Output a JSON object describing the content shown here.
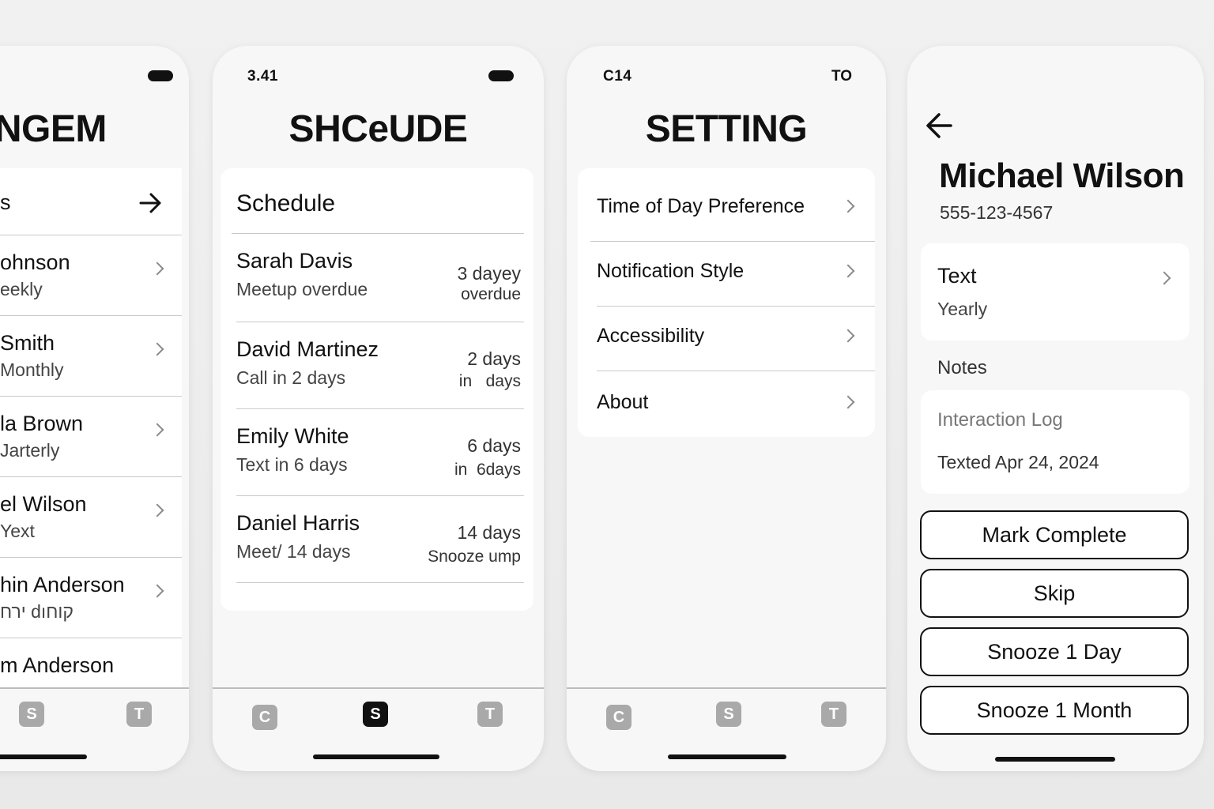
{
  "contacts_screen": {
    "title": "INGEM",
    "section_label": "s",
    "items": [
      {
        "name": "ohnson",
        "frequency": "eekly"
      },
      {
        "name": "Smith",
        "frequency": "Monthly"
      },
      {
        "name": "la Brown",
        "frequency": "Jarterly"
      },
      {
        "name": "el Wilson",
        "frequency": "Yext"
      },
      {
        "name": "hin Anderson",
        "frequency": "ירח dıקוח"
      },
      {
        "name": "m Anderson",
        "frequency": ""
      }
    ],
    "tabs": [
      "S",
      "T"
    ]
  },
  "schedule_screen": {
    "status_time": "3.41",
    "title": "SHCeUDE",
    "card_header": "Schedule",
    "items": [
      {
        "name": "Sarah Davis",
        "detail": "Meetup overdue",
        "due_primary": "3 dayey",
        "due_secondary": "overdue"
      },
      {
        "name": "David Martinez",
        "detail": "Call in 2 days",
        "due_primary": "2 days",
        "due_secondary": "in   days"
      },
      {
        "name": "Emily White",
        "detail": "Text in 6 days",
        "due_primary": "6 days",
        "due_secondary": "in  6days"
      },
      {
        "name": "Daniel Harris",
        "detail": "Meet/ 14 days",
        "due_primary": "14 days",
        "due_secondary": "Snooze ump"
      }
    ],
    "tabs": [
      "C",
      "S",
      "T"
    ]
  },
  "settings_screen": {
    "status_left": "C14",
    "status_right": "TO",
    "title": "SETTING",
    "items": [
      {
        "label": "Time of Day Preference"
      },
      {
        "label": "Notification Style"
      },
      {
        "label": "Accessibility"
      },
      {
        "label": "About"
      }
    ],
    "tabs": [
      "C",
      "S",
      "T"
    ]
  },
  "detail_screen": {
    "name": "Michael Wilson",
    "phone": "555-123-4567",
    "method": "Text",
    "frequency": "Yearly",
    "notes_label": "Notes",
    "log_title": "Interaction Log",
    "log_entry": "Texted Apr 24, 2024",
    "actions": [
      "Mark Complete",
      "Skip",
      "Snooze 1 Day",
      "Snooze 1 Month"
    ]
  },
  "colors": {
    "background": "#ececec",
    "card": "#ffffff",
    "text": "#111111",
    "inactive_tab": "#a9a9a9",
    "active_tab": "#111111",
    "divider": "#c9c9c9"
  }
}
